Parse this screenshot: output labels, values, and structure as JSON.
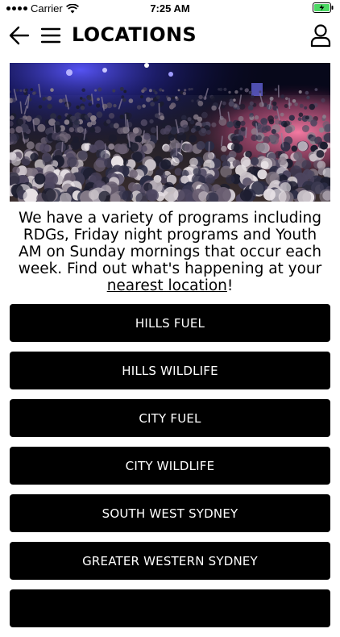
{
  "status_bar": {
    "carrier": "Carrier",
    "time": "7:25 AM",
    "battery_icon": "battery-charging-icon",
    "wifi_icon": "wifi-icon"
  },
  "header": {
    "back_icon": "back-arrow-icon",
    "menu_icon": "hamburger-menu-icon",
    "title": "LOCATIONS",
    "profile_icon": "user-profile-icon"
  },
  "hero": {
    "description": "Concert crowd photo"
  },
  "intro": {
    "text_before_link": "We have a variety of programs including RDGs, Friday night programs and Youth AM on Sunday mornings that occur each week. Find out what's happening at your ",
    "link_text": "nearest location",
    "text_after_link": "!"
  },
  "locations": [
    {
      "label": "HILLS FUEL"
    },
    {
      "label": "HILLS WILDLIFE"
    },
    {
      "label": "CITY FUEL"
    },
    {
      "label": "CITY WILDLIFE"
    },
    {
      "label": "SOUTH WEST SYDNEY"
    },
    {
      "label": "GREATER WESTERN SYDNEY"
    },
    {
      "label": ""
    }
  ],
  "colors": {
    "button_bg": "#000000",
    "button_text": "#ffffff",
    "background": "#ffffff",
    "battery_fill": "#4cd964"
  }
}
